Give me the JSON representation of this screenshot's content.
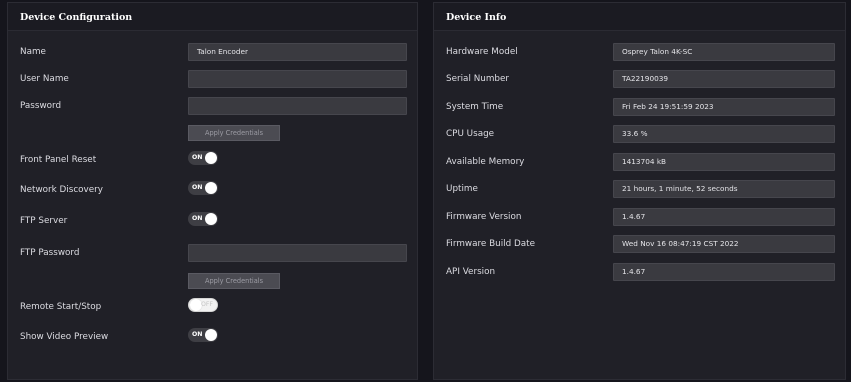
{
  "device_configuration": {
    "title": "Device Configuration",
    "name_label": "Name",
    "name_value": "Talon Encoder",
    "user_name_label": "User Name",
    "user_name_value": "",
    "password_label": "Password",
    "password_value": "",
    "apply_credentials_label": "Apply Credentials",
    "front_panel_reset_label": "Front Panel Reset",
    "front_panel_reset_state": "ON",
    "network_discovery_label": "Network Discovery",
    "network_discovery_state": "ON",
    "ftp_server_label": "FTP Server",
    "ftp_server_state": "ON",
    "ftp_password_label": "FTP Password",
    "ftp_password_value": "",
    "apply_ftp_credentials_label": "Apply Credentials",
    "remote_start_stop_label": "Remote Start/Stop",
    "remote_start_stop_state": "OFF",
    "show_video_preview_label": "Show Video Preview",
    "show_video_preview_state": "ON"
  },
  "device_info": {
    "title": "Device Info",
    "items": [
      {
        "label": "Hardware Model",
        "value": "Osprey Talon 4K-SC"
      },
      {
        "label": "Serial Number",
        "value": "TA22190039"
      },
      {
        "label": "System Time",
        "value": "Fri Feb 24 19:51:59 2023"
      },
      {
        "label": "CPU Usage",
        "value": "33.6 %"
      },
      {
        "label": "Available Memory",
        "value": "1413704 kB"
      },
      {
        "label": "Uptime",
        "value": "21 hours, 1 minute, 52 seconds"
      },
      {
        "label": "Firmware Version",
        "value": "1.4.67"
      },
      {
        "label": "Firmware Build Date",
        "value": "Wed Nov 16 08:47:19 CST 2022"
      },
      {
        "label": "API Version",
        "value": "1.4.67"
      }
    ]
  },
  "colors": {
    "page_background": "#15151c",
    "panel_background": "#202027",
    "field_background": "#3a3a40",
    "toggle_on_track": "#3e3e44",
    "toggle_off_track": "#f2f2f2"
  }
}
